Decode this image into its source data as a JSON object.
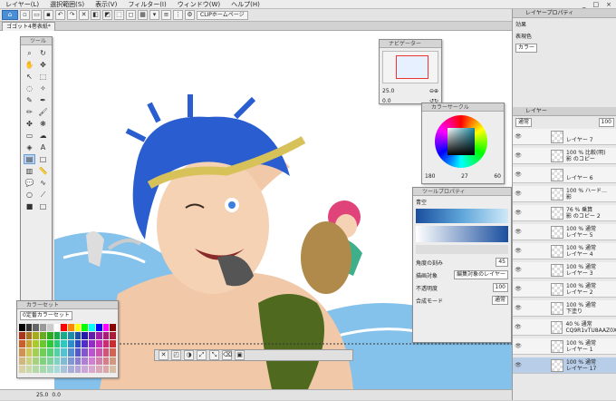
{
  "menu": [
    "レイヤー(L)",
    "選択範囲(S)",
    "表示(V)",
    "フィルター(I)",
    "ウィンドウ(W)",
    "ヘルプ(H)"
  ],
  "window_controls": [
    "_",
    "□",
    "×"
  ],
  "cmdbar": {
    "clip_label": "CLIPホームページ"
  },
  "document_tab": "ゴゴット4巻表紙*",
  "tool_panel": {
    "title": "ツール"
  },
  "navigator": {
    "title": "ナビゲーター",
    "zoom": "25.0",
    "angle": "0.0"
  },
  "color_circle": {
    "title": "カラーサークル",
    "h": "180",
    "s": "27",
    "v": "60"
  },
  "tool_property": {
    "title": "ツールプロパティ",
    "gradient_name": "青空",
    "angle_label": "角度の刻み",
    "angle_value": "45",
    "target_label": "描画対象",
    "target_value": "編集対象のレイヤー",
    "opacity_label": "不透明度",
    "opacity_value": "100",
    "blend_label": "合成モード",
    "blend_value": "通常"
  },
  "color_set": {
    "title": "カラーセット",
    "selector": "0定番カラーセット"
  },
  "layer_property": {
    "title": "レイヤープロパティ",
    "effect_label": "効果",
    "display_color_label": "表現色",
    "display_color_value": "カラー"
  },
  "layer_panel": {
    "title": "レイヤー",
    "blend": "通常",
    "opacity": "100",
    "layers": [
      {
        "l1": "",
        "l2": "レイヤー 7"
      },
      {
        "l1": "100 % 比較(明)",
        "l2": "影 のコピー"
      },
      {
        "l1": "",
        "l2": "レイヤー 6"
      },
      {
        "l1": "100 % ハード…",
        "l2": "影"
      },
      {
        "l1": "76 % 乗算",
        "l2": "影 のコピー 2"
      },
      {
        "l1": "100 % 通常",
        "l2": "レイヤー 5"
      },
      {
        "l1": "100 % 通常",
        "l2": "レイヤー 4"
      },
      {
        "l1": "100 % 通常",
        "l2": "レイヤー 3"
      },
      {
        "l1": "100 % 通常",
        "l2": "レイヤー 2"
      },
      {
        "l1": "100 % 通常",
        "l2": "下塗り"
      },
      {
        "l1": "40 % 通常",
        "l2": "CQ9R1vTU8AAZ0X"
      },
      {
        "l1": "100 % 通常",
        "l2": "レイヤー 1"
      },
      {
        "l1": "100 % 通常",
        "l2": "レイヤー 17"
      }
    ]
  },
  "status": {
    "zoom": "25.0",
    "angle": "0.0"
  },
  "colors": {
    "accent": "#4a8fd6",
    "hair": "#2a5ed0",
    "sky": "#7ec9f0",
    "water": "#6fb6e8"
  }
}
